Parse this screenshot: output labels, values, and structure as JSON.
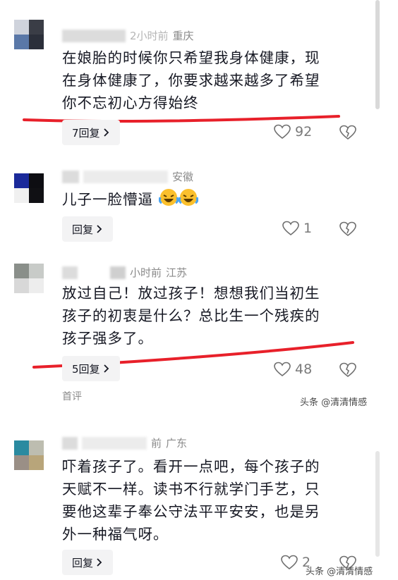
{
  "comments": [
    {
      "meta_time": "2小时前",
      "meta_location": "重庆",
      "text_lines": [
        "在娘胎的时候你只希望我身体健康，现",
        "在身体健康了，你要求越来越多了希望",
        "你不忘初心方得始终"
      ],
      "reply_label": "7回复",
      "likes": "92"
    },
    {
      "meta_location": "安徽",
      "text": "儿子一脸懵逼",
      "reply_label": "回复",
      "likes": "1"
    },
    {
      "meta_time": "小时前",
      "meta_location": "江苏",
      "text_lines": [
        "放过自己！放过孩子！想想我们当初生",
        "孩子的初衷是什么？总比生一个残疾的",
        "孩子强多了。"
      ],
      "reply_label": "5回复",
      "likes": "48",
      "badge": "首评"
    },
    {
      "meta_time": "前",
      "meta_location": "广东",
      "text_lines": [
        "吓着孩子了。看开一点吧，每个孩子的",
        "天赋不一样。读书不行就学门手艺，只",
        "要他这辈子奉公守法平平安安，也是另",
        "外一种福气呀。"
      ],
      "reply_label": "回复",
      "likes": "2"
    }
  ],
  "watermarks": [
    "头条 @清清情感",
    "头条 @清清情感"
  ],
  "icons": {
    "reply_chevron": "chevron-right-icon",
    "like": "heart-icon",
    "dislike": "broken-heart-icon",
    "emoji": "laughing-crying-emoji"
  },
  "colors": {
    "underline": "#e8202a",
    "accent_gray": "#8a8a8a"
  }
}
